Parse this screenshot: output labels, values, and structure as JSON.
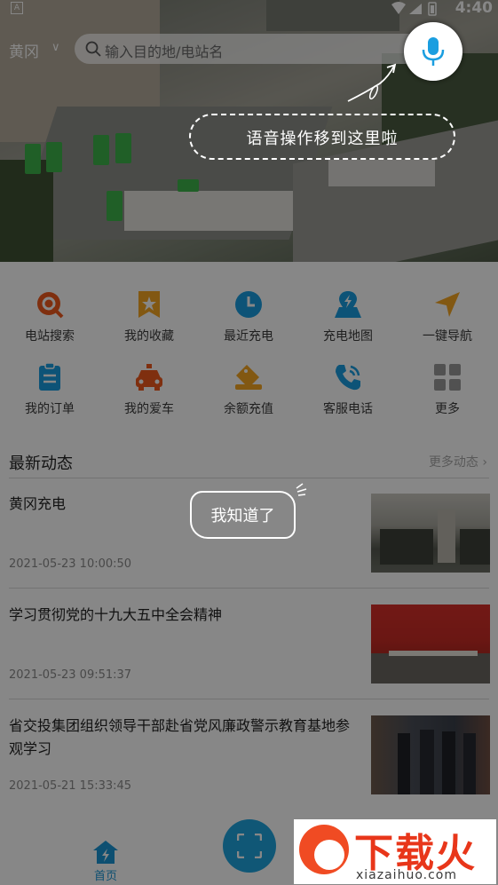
{
  "status_bar": {
    "time": "4:40",
    "notification_icon": "A"
  },
  "header": {
    "city": "黄冈",
    "search_placeholder": "输入目的地/电站名",
    "voice_button_icon": "mic-icon"
  },
  "onboarding": {
    "voice_tip": "语音操作移到这里啦",
    "dismiss_label": "我知道了"
  },
  "shortcuts": [
    {
      "label": "电站搜索",
      "icon": "station-search-icon",
      "color": "#f05a1e"
    },
    {
      "label": "我的收藏",
      "icon": "favorites-icon",
      "color": "#f5a623"
    },
    {
      "label": "最近充电",
      "icon": "recent-charge-clock-icon",
      "color": "#1a9ee0"
    },
    {
      "label": "充电地图",
      "icon": "charge-map-icon",
      "color": "#1a9ee0"
    },
    {
      "label": "一键导航",
      "icon": "navigation-arrow-icon",
      "color": "#f5a623"
    },
    {
      "label": "我的订单",
      "icon": "orders-clipboard-icon",
      "color": "#1a9ee0"
    },
    {
      "label": "我的爱车",
      "icon": "car-icon",
      "color": "#f05a1e"
    },
    {
      "label": "余额充值",
      "icon": "recharge-tag-icon",
      "color": "#f5a623"
    },
    {
      "label": "客服电话",
      "icon": "phone-icon",
      "color": "#1a9ee0"
    },
    {
      "label": "更多",
      "icon": "more-grid-icon",
      "color": "#9a9a9a"
    }
  ],
  "news": {
    "section_title": "最新动态",
    "more_label": "更多动态",
    "items": [
      {
        "title": "黄冈充电",
        "time": "2021-05-23 10:00:50"
      },
      {
        "title": "学习贯彻党的十九大五中全会精神",
        "time": "2021-05-23 09:51:37"
      },
      {
        "title": "省交投集团组织领导干部赴省党风廉政警示教育基地参观学习",
        "time": "2021-05-21 15:33:45"
      }
    ]
  },
  "bottom_nav": {
    "home_label": "首页",
    "scan_icon": "scan-icon"
  },
  "watermark": {
    "brand": "下载火",
    "url": "xiazaihuo.com"
  }
}
